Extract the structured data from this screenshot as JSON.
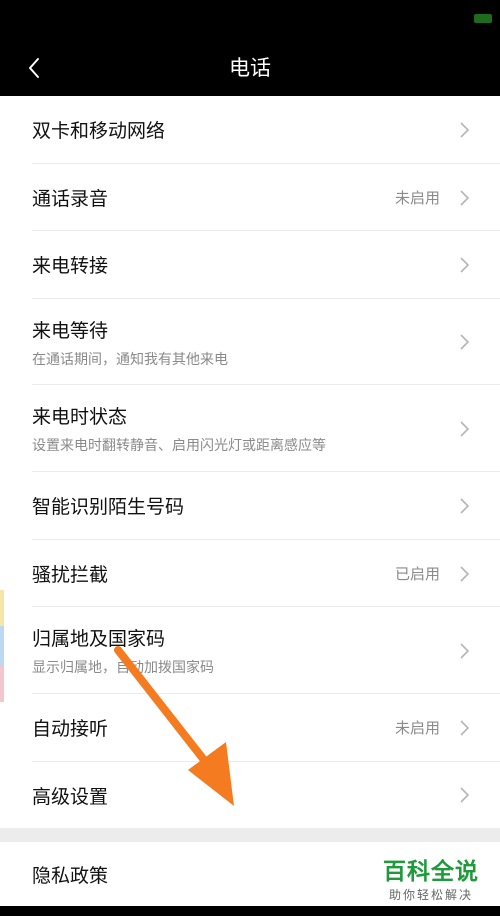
{
  "header": {
    "title": "电话",
    "back_icon": "chevron-left-icon"
  },
  "rows": [
    {
      "label": "双卡和移动网络",
      "sub": "",
      "value": ""
    },
    {
      "label": "通话录音",
      "sub": "",
      "value": "未启用"
    },
    {
      "label": "来电转接",
      "sub": "",
      "value": ""
    },
    {
      "label": "来电等待",
      "sub": "在通话期间，通知我有其他来电",
      "value": ""
    },
    {
      "label": "来电时状态",
      "sub": "设置来电时翻转静音、启用闪光灯或距离感应等",
      "value": ""
    },
    {
      "label": "智能识别陌生号码",
      "sub": "",
      "value": ""
    },
    {
      "label": "骚扰拦截",
      "sub": "",
      "value": "已启用"
    },
    {
      "label": "归属地及国家码",
      "sub": "显示归属地，自动加拨国家码",
      "value": ""
    },
    {
      "label": "自动接听",
      "sub": "",
      "value": "未启用"
    },
    {
      "label": "高级设置",
      "sub": "",
      "value": ""
    }
  ],
  "footer_item": {
    "label": "隐私政策"
  },
  "watermark": {
    "title": "百科全说",
    "subtitle": "助你轻松解决"
  },
  "colors": {
    "annotation_arrow": "#f47b20",
    "watermark_green": "#1e9a3a"
  }
}
